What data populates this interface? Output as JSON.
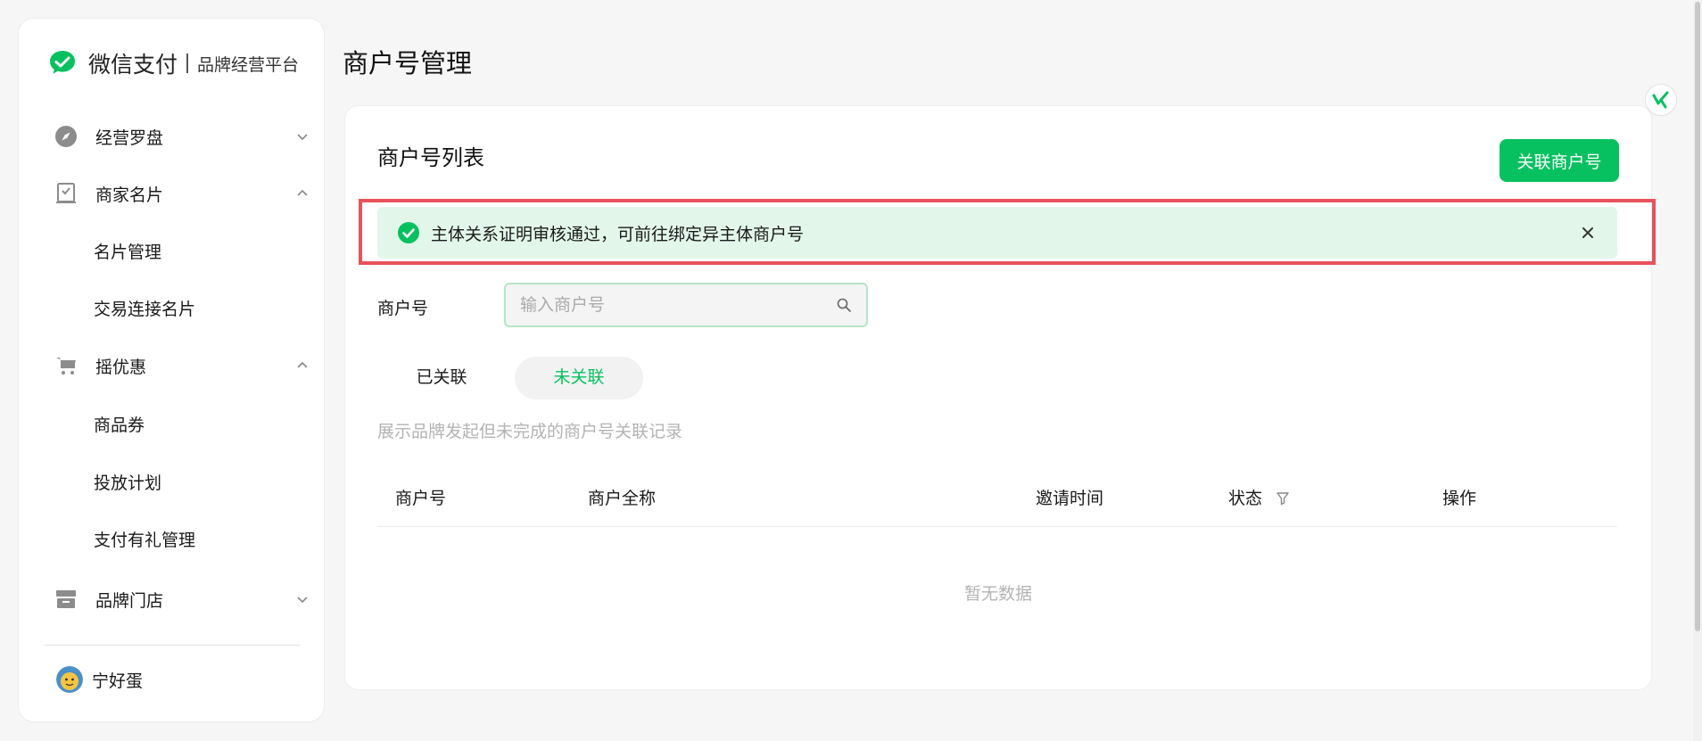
{
  "brand": {
    "name": "微信支付",
    "subtitle": "品牌经营平台",
    "accent": "#07c160"
  },
  "sidebar": {
    "items": [
      {
        "label": "经营罗盘",
        "icon": "compass-icon",
        "expanded": false
      },
      {
        "label": "商家名片",
        "icon": "card-icon",
        "expanded": true,
        "children": [
          "名片管理",
          "交易连接名片"
        ]
      },
      {
        "label": "摇优惠",
        "icon": "cart-icon",
        "expanded": true,
        "children": [
          "商品券",
          "投放计划",
          "支付有礼管理"
        ]
      },
      {
        "label": "品牌门店",
        "icon": "store-icon",
        "expanded": false
      }
    ],
    "user": {
      "name": "宁好蛋"
    }
  },
  "page": {
    "title": "商户号管理"
  },
  "card": {
    "title": "商户号列表",
    "primary_button": "关联商户号",
    "alert": {
      "text": "主体关系证明审核通过，可前往绑定异主体商户号",
      "status_color": "#07c160",
      "highlight_color": "#e8525a"
    },
    "search": {
      "label": "商户号",
      "value": "",
      "placeholder": "输入商户号"
    },
    "tabs": [
      {
        "label": "已关联",
        "selected": false
      },
      {
        "label": "未关联",
        "selected": true
      }
    ],
    "hint": "展示品牌发起但未完成的商户号关联记录",
    "table": {
      "columns": [
        "商户号",
        "商户全称",
        "邀请时间",
        "状态",
        "操作"
      ],
      "rows": [],
      "empty_text": "暂无数据"
    }
  }
}
